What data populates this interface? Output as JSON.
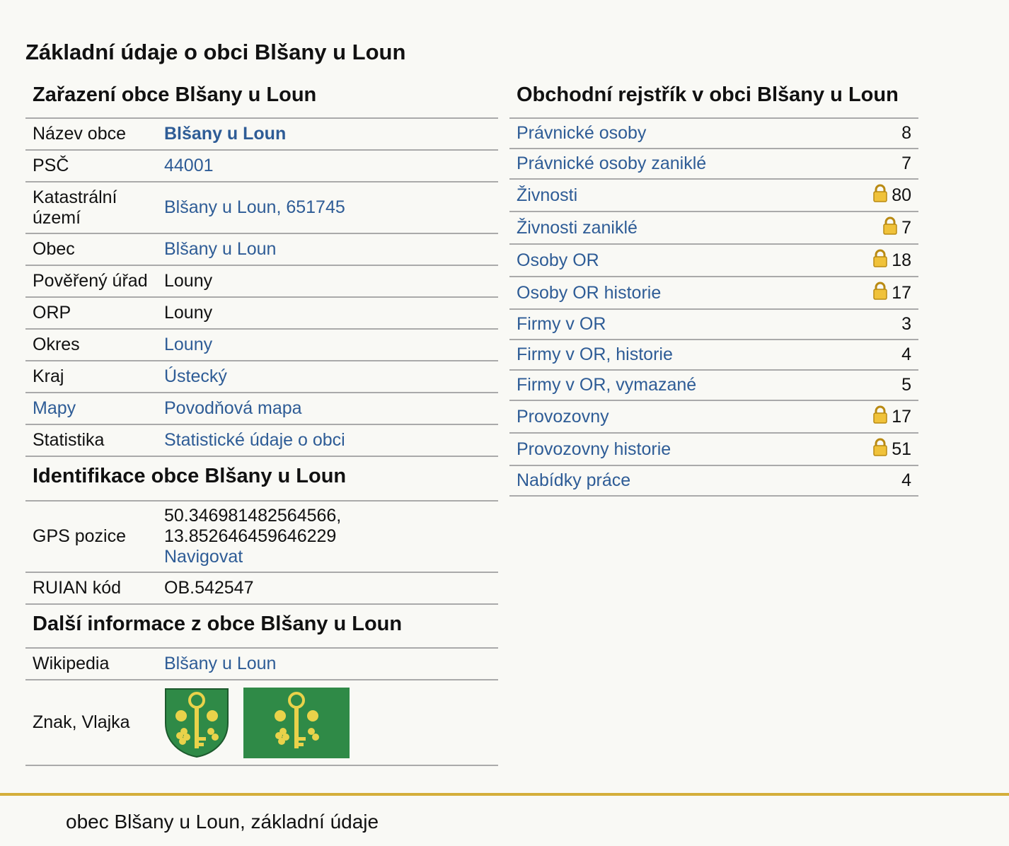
{
  "page_title": "Základní údaje o obci Blšany u Loun",
  "zarazeni": {
    "heading": "Zařazení obce Blšany u Loun",
    "rows": [
      {
        "label": "Název obce",
        "value": "Blšany u Loun"
      },
      {
        "label": "PSČ",
        "value": "44001"
      },
      {
        "label": "Katastrální území",
        "value": "Blšany u Loun, 651745"
      },
      {
        "label": "Obec",
        "value": "Blšany u Loun"
      },
      {
        "label": "Pověřený úřad",
        "value": "Louny"
      },
      {
        "label": "ORP",
        "value": "Louny"
      },
      {
        "label": "Okres",
        "value": "Louny"
      },
      {
        "label": "Kraj",
        "value": "Ústecký"
      },
      {
        "label": "Mapy",
        "value": "Povodňová mapa"
      },
      {
        "label": "Statistika",
        "value": "Statistické údaje o obci"
      }
    ]
  },
  "identifikace": {
    "heading": "Identifikace obce Blšany u Loun",
    "gps_label": "GPS pozice",
    "gps_lat": "50.346981482564566,",
    "gps_lon": "13.852646459646229",
    "navigate": "Navigovat",
    "ruian_label": "RUIAN kód",
    "ruian_value": "OB.542547"
  },
  "dalsi": {
    "heading": "Další informace z obce Blšany u Loun",
    "wiki_label": "Wikipedia",
    "wiki_value": "Blšany u Loun",
    "znak_label": "Znak, Vlajka"
  },
  "rejstrik": {
    "heading": "Obchodní rejstřík v obci Blšany u Loun",
    "rows": [
      {
        "label": "Právnické osoby",
        "count": "8",
        "locked": false
      },
      {
        "label": "Právnické osoby zaniklé",
        "count": "7",
        "locked": false
      },
      {
        "label": "Živnosti",
        "count": "80",
        "locked": true
      },
      {
        "label": "Živnosti zaniklé",
        "count": "7",
        "locked": true
      },
      {
        "label": "Osoby OR",
        "count": "18",
        "locked": true
      },
      {
        "label": "Osoby OR historie",
        "count": "17",
        "locked": true
      },
      {
        "label": "Firmy v OR",
        "count": "3",
        "locked": false
      },
      {
        "label": "Firmy v OR, historie",
        "count": "4",
        "locked": false
      },
      {
        "label": "Firmy v OR, vymazané",
        "count": "5",
        "locked": false
      },
      {
        "label": "Provozovny",
        "count": "17",
        "locked": true
      },
      {
        "label": "Provozovny historie",
        "count": "51",
        "locked": true
      },
      {
        "label": "Nabídky práce",
        "count": "4",
        "locked": false
      }
    ]
  },
  "footer": {
    "text": "obec Blšany u Loun, základní údaje"
  },
  "colors": {
    "link": "#2e5c96",
    "footer_rule": "#d4ae3a",
    "coat_green": "#2f8a47",
    "coat_gold": "#e9d24a"
  }
}
